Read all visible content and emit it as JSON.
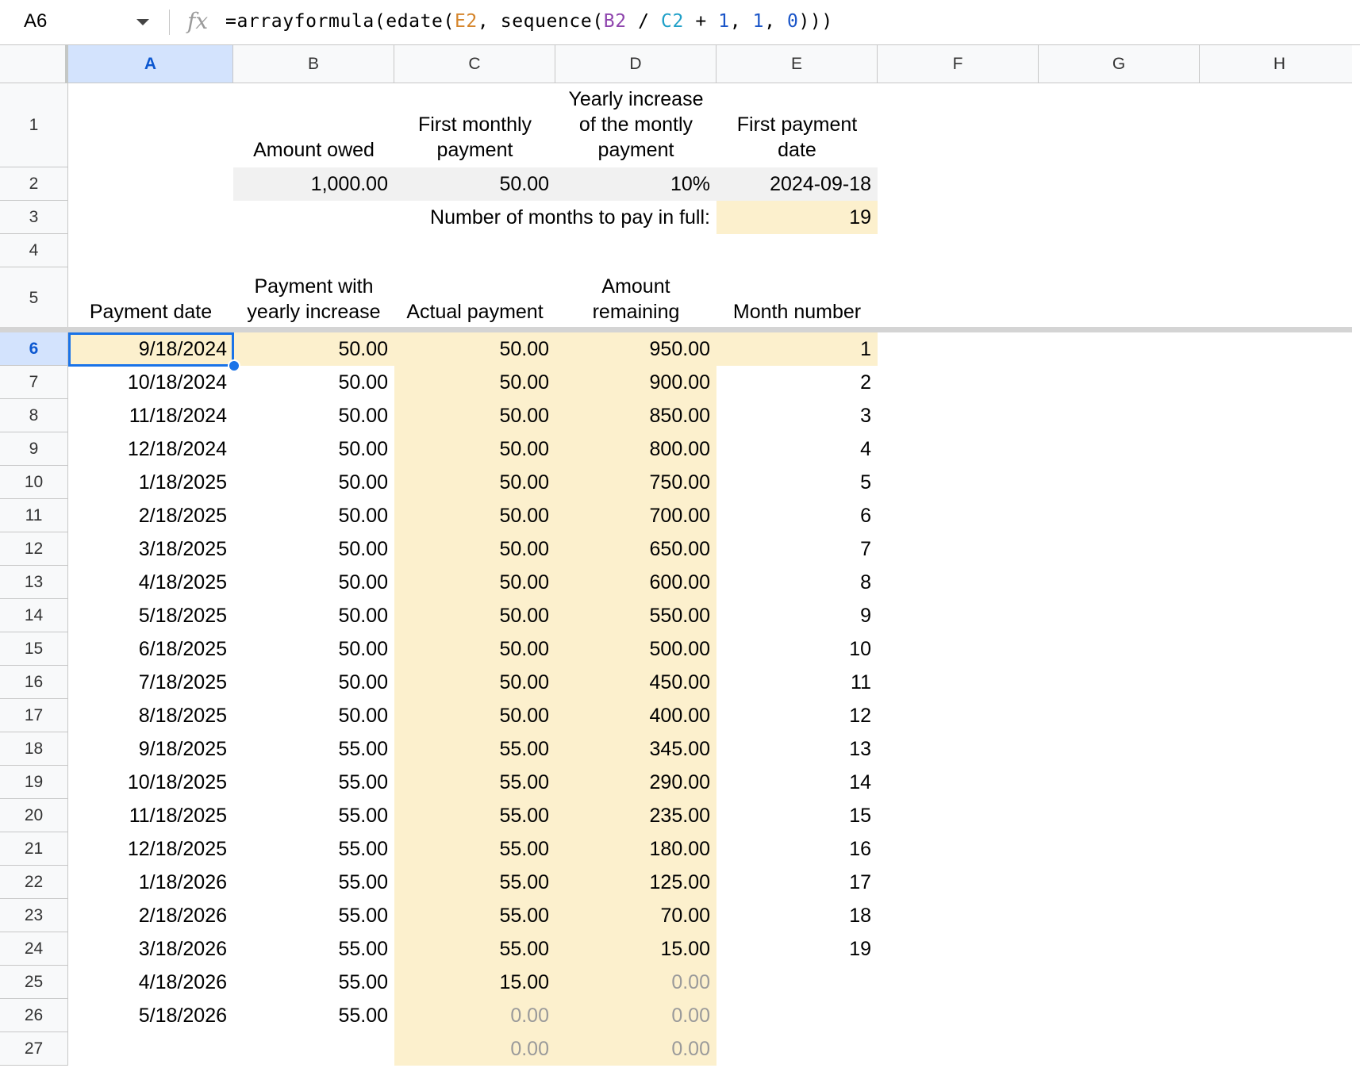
{
  "namebox": {
    "value": "A6"
  },
  "formula": {
    "prefix": "=arrayformula(edate(",
    "ref1": "E2",
    "mid1": ", sequence(",
    "ref2": "B2",
    "mid2": " / ",
    "ref3": "C2",
    "mid3": " + ",
    "n1": "1",
    "mid4": ", ",
    "n2": "1",
    "mid5": ", ",
    "n3": "0",
    "suffix": ")))"
  },
  "columns": [
    "A",
    "B",
    "C",
    "D",
    "E",
    "F",
    "G",
    "H"
  ],
  "rows": [
    "1",
    "2",
    "3",
    "4",
    "5",
    "6",
    "7",
    "8",
    "9",
    "10",
    "11",
    "12",
    "13",
    "14",
    "15",
    "16",
    "17",
    "18",
    "19",
    "20",
    "21",
    "22",
    "23",
    "24",
    "25",
    "26",
    "27"
  ],
  "headers_top": {
    "amount_owed": "Amount owed",
    "first_monthly_payment": "First monthly payment",
    "yearly_increase": "Yearly increase of the montly payment",
    "first_payment_date": "First payment date"
  },
  "inputs": {
    "amount_owed": "1,000.00",
    "first_monthly_payment": "50.00",
    "yearly_increase": "10%",
    "first_payment_date": "2024-09-18"
  },
  "months_label": "Number of months to pay in full:",
  "months_value": "19",
  "table_headers": {
    "payment_date": "Payment date",
    "payment_with_increase": "Payment with yearly increase",
    "actual_payment": "Actual payment",
    "amount_remaining": "Amount remaining",
    "month_number": "Month number"
  },
  "table_rows": [
    {
      "date": "9/18/2024",
      "pwi": "50.00",
      "actual": "50.00",
      "remaining": "950.00",
      "month": "1"
    },
    {
      "date": "10/18/2024",
      "pwi": "50.00",
      "actual": "50.00",
      "remaining": "900.00",
      "month": "2"
    },
    {
      "date": "11/18/2024",
      "pwi": "50.00",
      "actual": "50.00",
      "remaining": "850.00",
      "month": "3"
    },
    {
      "date": "12/18/2024",
      "pwi": "50.00",
      "actual": "50.00",
      "remaining": "800.00",
      "month": "4"
    },
    {
      "date": "1/18/2025",
      "pwi": "50.00",
      "actual": "50.00",
      "remaining": "750.00",
      "month": "5"
    },
    {
      "date": "2/18/2025",
      "pwi": "50.00",
      "actual": "50.00",
      "remaining": "700.00",
      "month": "6"
    },
    {
      "date": "3/18/2025",
      "pwi": "50.00",
      "actual": "50.00",
      "remaining": "650.00",
      "month": "7"
    },
    {
      "date": "4/18/2025",
      "pwi": "50.00",
      "actual": "50.00",
      "remaining": "600.00",
      "month": "8"
    },
    {
      "date": "5/18/2025",
      "pwi": "50.00",
      "actual": "50.00",
      "remaining": "550.00",
      "month": "9"
    },
    {
      "date": "6/18/2025",
      "pwi": "50.00",
      "actual": "50.00",
      "remaining": "500.00",
      "month": "10"
    },
    {
      "date": "7/18/2025",
      "pwi": "50.00",
      "actual": "50.00",
      "remaining": "450.00",
      "month": "11"
    },
    {
      "date": "8/18/2025",
      "pwi": "50.00",
      "actual": "50.00",
      "remaining": "400.00",
      "month": "12"
    },
    {
      "date": "9/18/2025",
      "pwi": "55.00",
      "actual": "55.00",
      "remaining": "345.00",
      "month": "13"
    },
    {
      "date": "10/18/2025",
      "pwi": "55.00",
      "actual": "55.00",
      "remaining": "290.00",
      "month": "14"
    },
    {
      "date": "11/18/2025",
      "pwi": "55.00",
      "actual": "55.00",
      "remaining": "235.00",
      "month": "15"
    },
    {
      "date": "12/18/2025",
      "pwi": "55.00",
      "actual": "55.00",
      "remaining": "180.00",
      "month": "16"
    },
    {
      "date": "1/18/2026",
      "pwi": "55.00",
      "actual": "55.00",
      "remaining": "125.00",
      "month": "17"
    },
    {
      "date": "2/18/2026",
      "pwi": "55.00",
      "actual": "55.00",
      "remaining": "70.00",
      "month": "18"
    },
    {
      "date": "3/18/2026",
      "pwi": "55.00",
      "actual": "55.00",
      "remaining": "15.00",
      "month": "19"
    },
    {
      "date": "4/18/2026",
      "pwi": "55.00",
      "actual": "15.00",
      "remaining": "0.00",
      "month": ""
    },
    {
      "date": "5/18/2026",
      "pwi": "55.00",
      "actual": "0.00",
      "remaining": "0.00",
      "month": ""
    },
    {
      "date": "",
      "pwi": "",
      "actual": "0.00",
      "remaining": "0.00",
      "month": ""
    }
  ],
  "colors": {
    "highlight_yellow": "#fcf0cd",
    "input_gray": "#f1f1f1",
    "selection_blue": "#1a73e8",
    "muted_text": "#9a9a9a"
  }
}
